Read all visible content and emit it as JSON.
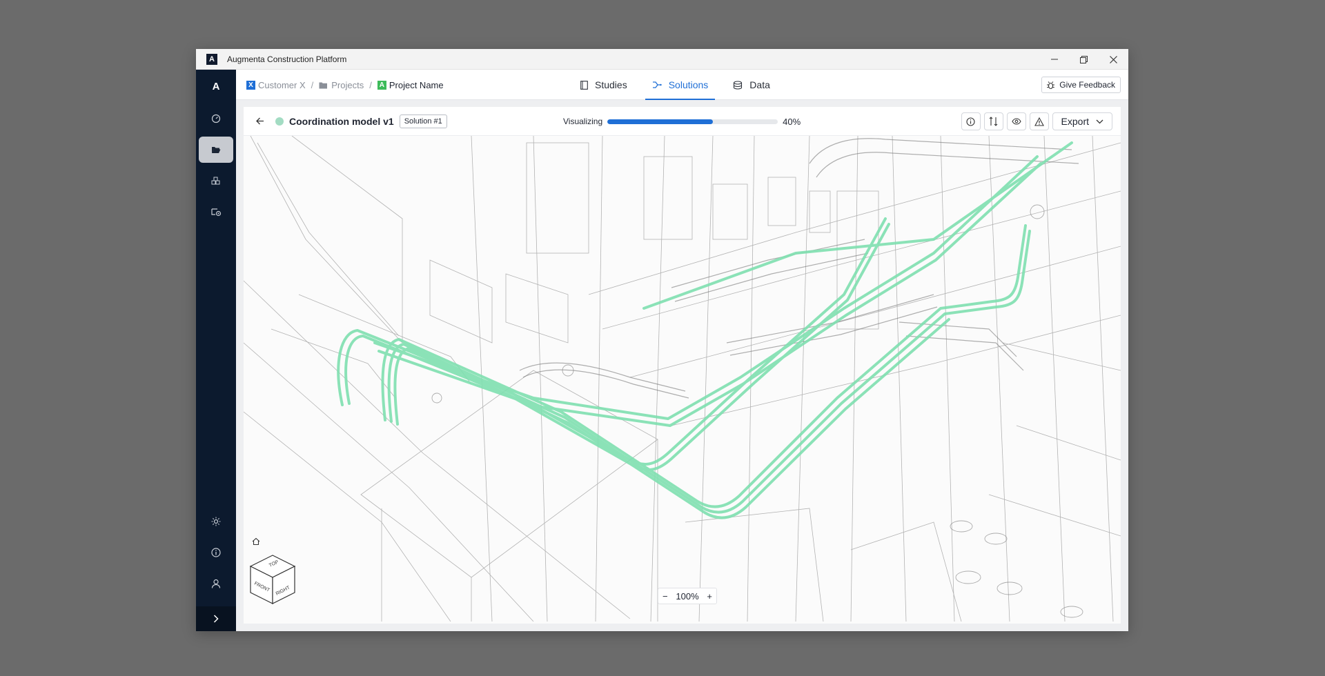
{
  "window": {
    "title": "Augmenta Construction Platform",
    "logo_letter": "A"
  },
  "sidebar": {
    "logo": "A",
    "items": [
      {
        "name": "dashboard",
        "icon": "gauge-icon"
      },
      {
        "name": "projects",
        "icon": "folder-open-icon",
        "active": true
      },
      {
        "name": "components",
        "icon": "blocks-icon"
      },
      {
        "name": "routing-settings",
        "icon": "route-gear-icon"
      }
    ],
    "bottom_items": [
      {
        "name": "theme",
        "icon": "sun-icon"
      },
      {
        "name": "info",
        "icon": "info-icon"
      },
      {
        "name": "account",
        "icon": "user-icon"
      }
    ]
  },
  "breadcrumb": {
    "customer": {
      "badge": "X",
      "label": "Customer X",
      "color": "#1f6fd6"
    },
    "projects": {
      "label": "Projects"
    },
    "project": {
      "badge": "A",
      "label": "Project Name",
      "color": "#3dbb5a"
    },
    "separator": "/"
  },
  "tabs": [
    {
      "label": "Studies",
      "icon": "document-icon",
      "active": false
    },
    {
      "label": "Solutions",
      "icon": "branches-icon",
      "active": true
    },
    {
      "label": "Data",
      "icon": "database-icon",
      "active": false
    }
  ],
  "feedback": {
    "label": "Give Feedback",
    "icon": "bug-icon"
  },
  "panel": {
    "model_name": "Coordination model v1",
    "solution_tag": "Solution #1",
    "status_color": "#a3dcc3",
    "progress": {
      "label": "Visualizing",
      "value": 0.62,
      "percent_label": "40%"
    },
    "tools": [
      "info-icon",
      "compare-icon",
      "eye-icon",
      "warning-icon"
    ],
    "export_label": "Export"
  },
  "viewport": {
    "pipe_color": "#7fe0b0",
    "view_cube": {
      "top": "TOP",
      "front": "FRONT",
      "right": "RIGHT"
    },
    "zoom": {
      "value": "100%",
      "minus": "−",
      "plus": "+"
    }
  }
}
